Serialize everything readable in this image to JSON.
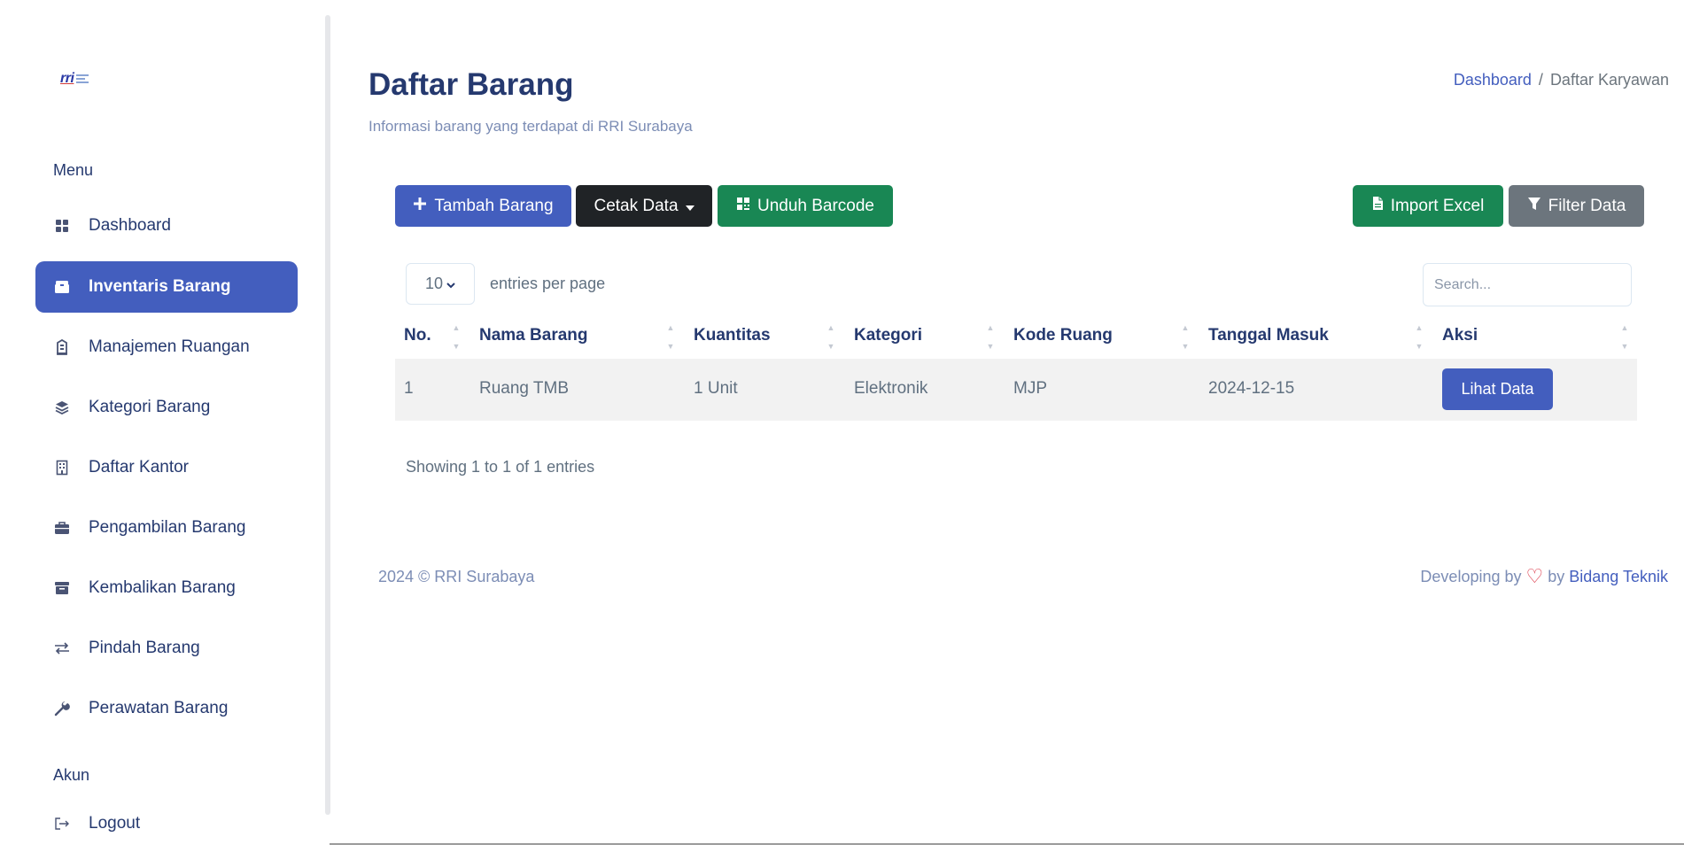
{
  "sidebar": {
    "logo_text": "rri",
    "menu_title": "Menu",
    "account_title": "Akun",
    "items": [
      {
        "label": "Dashboard",
        "icon": "grid-icon"
      },
      {
        "label": "Inventaris Barang",
        "icon": "box-icon"
      },
      {
        "label": "Manajemen Ruangan",
        "icon": "building-icon"
      },
      {
        "label": "Kategori Barang",
        "icon": "stack-icon"
      },
      {
        "label": "Daftar Kantor",
        "icon": "office-icon"
      },
      {
        "label": "Pengambilan Barang",
        "icon": "briefcase-icon"
      },
      {
        "label": "Kembalikan Barang",
        "icon": "archive-icon"
      },
      {
        "label": "Pindah Barang",
        "icon": "arrows-icon"
      },
      {
        "label": "Perawatan Barang",
        "icon": "wrench-icon"
      }
    ],
    "logout_label": "Logout"
  },
  "header": {
    "title": "Daftar Barang",
    "subtitle": "Informasi barang yang terdapat di RRI Surabaya",
    "breadcrumb": [
      "Dashboard",
      "Daftar Karyawan"
    ]
  },
  "toolbar": {
    "add_label": "Tambah Barang",
    "print_label": "Cetak Data",
    "barcode_label": "Unduh Barcode",
    "import_label": "Import Excel",
    "filter_label": "Filter Data"
  },
  "table": {
    "page_size": "10",
    "entries_label": "entries per page",
    "search_placeholder": "Search...",
    "columns": [
      "No.",
      "Nama Barang",
      "Kuantitas",
      "Kategori",
      "Kode Ruang",
      "Tanggal Masuk",
      "Aksi"
    ],
    "rows": [
      {
        "no": "1",
        "nama": "Ruang TMB",
        "kuantitas": "1 Unit",
        "kategori": "Elektronik",
        "kode": "MJP",
        "tanggal": "2024-12-15",
        "aksi": "Lihat Data"
      }
    ],
    "info": "Showing 1 to 1 of 1 entries"
  },
  "footer": {
    "copyright": "2024 © RRI Surabaya",
    "dev_prefix": "Developing by",
    "dev_by": "by",
    "dev_team": "Bidang Teknik"
  },
  "colors": {
    "primary": "#435ebe",
    "success": "#198754",
    "dark": "#202326",
    "secondary": "#6c757d"
  }
}
